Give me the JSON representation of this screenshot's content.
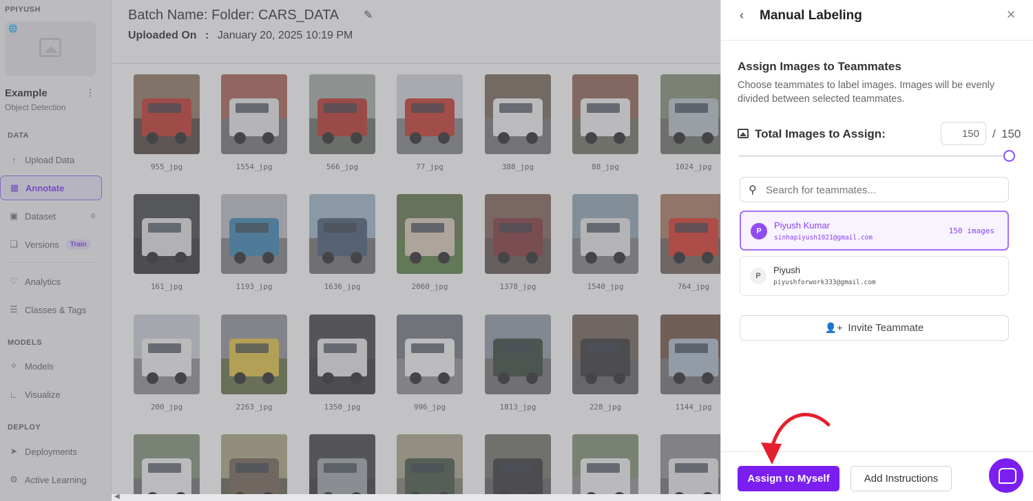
{
  "sidebar": {
    "workspace": "PPIYUSH",
    "project_name": "Example",
    "project_type": "Object Detection",
    "sections": {
      "data": "DATA",
      "models": "MODELS",
      "deploy": "DEPLOY"
    },
    "items": [
      {
        "label": "Upload Data",
        "icon": "upload-icon"
      },
      {
        "label": "Annotate",
        "icon": "annotate-icon",
        "active": true
      },
      {
        "label": "Dataset",
        "icon": "dataset-icon",
        "badge": "0"
      },
      {
        "label": "Versions",
        "icon": "versions-icon",
        "pill": "Train"
      },
      {
        "label": "Analytics",
        "icon": "analytics-icon"
      },
      {
        "label": "Classes & Tags",
        "icon": "classes-icon"
      },
      {
        "label": "Models",
        "icon": "models-icon"
      },
      {
        "label": "Visualize",
        "icon": "visualize-icon"
      },
      {
        "label": "Deployments",
        "icon": "deployments-icon"
      },
      {
        "label": "Active Learning",
        "icon": "active-learning-icon"
      }
    ]
  },
  "header": {
    "batch_label": "Batch Name:",
    "batch_name": "Folder: CARS_DATA",
    "uploaded_label": "Uploaded On",
    "uploaded_sep": ":",
    "uploaded_value": "January 20, 2025 10:19 PM"
  },
  "images": [
    {
      "name": "955_jpg",
      "sky": "#8a6f5a",
      "car": "#c0281f",
      "gnd": "#4a3b33"
    },
    {
      "name": "1554_jpg",
      "sky": "#a8584a",
      "car": "#e8e8e8",
      "gnd": "#6d6d6d"
    },
    {
      "name": "566_jpg",
      "sky": "#9ea8a2",
      "car": "#b8271c",
      "gnd": "#606860"
    },
    {
      "name": "77_jpg",
      "sky": "#cfd4da",
      "car": "#c42a1e",
      "gnd": "#7d7e80"
    },
    {
      "name": "388_jpg",
      "sky": "#6f604f",
      "car": "#f2f2f2",
      "gnd": "#707070"
    },
    {
      "name": "88_jpg",
      "sky": "#8a5c4c",
      "car": "#f0f0f0",
      "gnd": "#6a6a5e"
    },
    {
      "name": "1024_jpg",
      "sky": "#7e8b70",
      "car": "#b6bec6",
      "gnd": "#646a60"
    },
    {
      "name": "161_jpg",
      "sky": "#3a3c40",
      "car": "#e2e2e2",
      "gnd": "#2a2a2a"
    },
    {
      "name": "1193_jpg",
      "sky": "#b8bcc4",
      "car": "#2f7fb0",
      "gnd": "#7a7a7a"
    },
    {
      "name": "1636_jpg",
      "sky": "#9cb4c8",
      "car": "#3d4f6e",
      "gnd": "#6b6b6b"
    },
    {
      "name": "2060_jpg",
      "sky": "#5a6e40",
      "car": "#d9c8b6",
      "gnd": "#4f7a3a"
    },
    {
      "name": "1378_jpg",
      "sky": "#7a5a50",
      "car": "#7a2a2e",
      "gnd": "#5a4a45"
    },
    {
      "name": "1540_jpg",
      "sky": "#8ba0b0",
      "car": "#e6e6e6",
      "gnd": "#7a7a7a"
    },
    {
      "name": "764_jpg",
      "sky": "#a6735a",
      "car": "#d82a1c",
      "gnd": "#6a5a50"
    },
    {
      "name": "200_jpg",
      "sky": "#c8cfd8",
      "car": "#f0f0f0",
      "gnd": "#8a8a8a"
    },
    {
      "name": "2263_jpg",
      "sky": "#8a8f96",
      "car": "#e3c23a",
      "gnd": "#5b6a3a"
    },
    {
      "name": "1350_jpg",
      "sky": "#3a3a3a",
      "car": "#e6e6e6",
      "gnd": "#2c2c2c"
    },
    {
      "name": "996_jpg",
      "sky": "#6b7078",
      "car": "#f4f4f4",
      "gnd": "#8a8a8a"
    },
    {
      "name": "1813_jpg",
      "sky": "#8c949e",
      "car": "#2b3a2e",
      "gnd": "#6a6a6a"
    },
    {
      "name": "228_jpg",
      "sky": "#6a5a4e",
      "car": "#2a2a2a",
      "gnd": "#5a5a5a"
    },
    {
      "name": "1144_jpg",
      "sky": "#6a4a3a",
      "car": "#a9b8c8",
      "gnd": "#6a6a6a"
    },
    {
      "name": "",
      "sky": "#7c8a70",
      "car": "#f2f2f2",
      "gnd": "#6a6a6a"
    },
    {
      "name": "",
      "sky": "#a6a07a",
      "car": "#6a5a4a",
      "gnd": "#5a5a4a"
    },
    {
      "name": "",
      "sky": "#3a3a3a",
      "car": "#9aa0a6",
      "gnd": "#2e2e2e"
    },
    {
      "name": "",
      "sky": "#a8a086",
      "car": "#3a4a3a",
      "gnd": "#7a7a6a"
    },
    {
      "name": "",
      "sky": "#6a6a60",
      "car": "#2a2a2a",
      "gnd": "#5a5a5a"
    },
    {
      "name": "",
      "sky": "#7a8a6a",
      "car": "#f0f0f0",
      "gnd": "#8a8a8a"
    },
    {
      "name": "",
      "sky": "#8a8a8a",
      "car": "#e8e8e8",
      "gnd": "#6a6a6a"
    }
  ],
  "drawer": {
    "title": "Manual Labeling",
    "heading": "Assign Images to Teammates",
    "description": "Choose teammates to label images. Images will be evenly divided between selected teammates.",
    "total_label": "Total Images to Assign:",
    "total_value": "150",
    "total_sep": "/",
    "total_max": "150",
    "slider_fraction": 1.0,
    "search_placeholder": "Search for teammates...",
    "members": [
      {
        "initial": "P",
        "name": "Piyush Kumar",
        "email": "sinhapiyush1021@gmail.com",
        "count": "150 images",
        "selected": true
      },
      {
        "initial": "P",
        "name": "Piyush",
        "email": "piyushforwork333@gmail.com",
        "count": "",
        "selected": false
      }
    ],
    "invite_label": "Invite Teammate",
    "assign_label": "Assign to Myself",
    "instructions_label": "Add Instructions"
  },
  "colors": {
    "accent": "#7a1ff0",
    "annotation_arrow": "#e5202e"
  }
}
